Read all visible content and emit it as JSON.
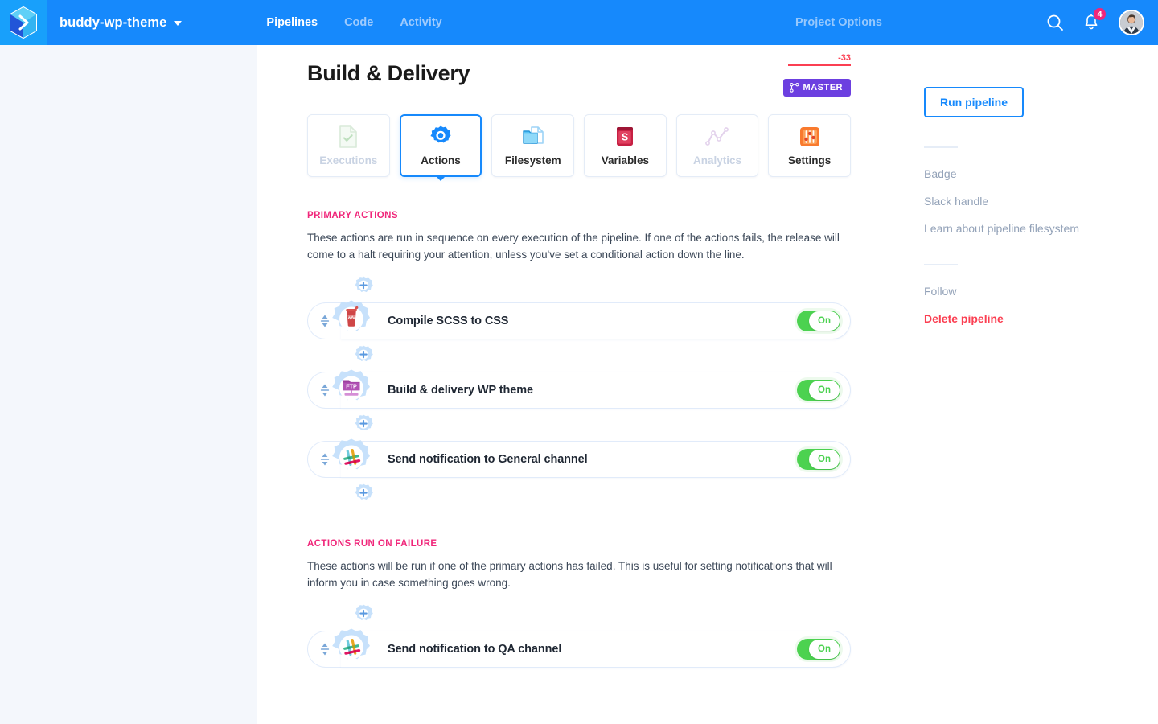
{
  "topbar": {
    "logo_icon": "buddy-hexagon-logo",
    "project_name": "buddy-wp-theme",
    "nav": [
      {
        "label": "Pipelines",
        "active": true
      },
      {
        "label": "Code",
        "active": false
      },
      {
        "label": "Activity",
        "active": false
      }
    ],
    "project_options_label": "Project Options",
    "search_icon": "search-icon",
    "notifications_icon": "bell-icon",
    "notifications_count": "4",
    "avatar": "user-avatar"
  },
  "header": {
    "title": "Build & Delivery",
    "delta": "-33",
    "branch_icon": "branch-icon",
    "branch": "MASTER"
  },
  "tabs": [
    {
      "label": "Executions",
      "icon": "document-check-icon",
      "active": false,
      "disabled": true
    },
    {
      "label": "Actions",
      "icon": "gear-icon",
      "active": true,
      "disabled": false
    },
    {
      "label": "Filesystem",
      "icon": "files-icon",
      "active": false,
      "disabled": false
    },
    {
      "label": "Variables",
      "icon": "dollar-book-icon",
      "active": false,
      "disabled": false
    },
    {
      "label": "Analytics",
      "icon": "line-chart-icon",
      "active": false,
      "disabled": true
    },
    {
      "label": "Settings",
      "icon": "sliders-icon",
      "active": false,
      "disabled": false
    }
  ],
  "primary_section": {
    "title": "PRIMARY ACTIONS",
    "description": "These actions are run in sequence on every execution of the pipeline. If one of the actions fails, the release will come to a halt requiring your attention, unless you've set a conditional action down the line.",
    "actions": [
      {
        "label": "Compile SCSS to CSS",
        "icon": "gulp-icon",
        "toggle": "On"
      },
      {
        "label": "Build & delivery WP theme",
        "icon": "ftp-icon",
        "toggle": "On"
      },
      {
        "label": "Send notification to General channel",
        "icon": "slack-icon",
        "toggle": "On"
      }
    ]
  },
  "failure_section": {
    "title": "ACTIONS RUN ON FAILURE",
    "description": "These actions will be run if one of the primary actions has failed. This is useful for setting notifications that will inform you in case something goes wrong.",
    "actions": [
      {
        "label": "Send notification to QA channel",
        "icon": "slack-icon",
        "toggle": "On"
      }
    ]
  },
  "add_action_icon": "add-action-plus-icon",
  "drag_handle_icon": "drag-handle-icon",
  "sidebar": {
    "run_button": "Run pipeline",
    "group1": [
      {
        "label": "Badge",
        "danger": false
      },
      {
        "label": "Slack handle",
        "danger": false
      },
      {
        "label": "Learn about pipeline filesystem",
        "danger": false
      }
    ],
    "group2": [
      {
        "label": "Follow",
        "danger": false
      },
      {
        "label": "Delete pipeline",
        "danger": true
      }
    ]
  },
  "colors": {
    "brand_blue": "#1689fc",
    "accent_pink": "#f0267a",
    "toggle_green": "#4cd250",
    "danger_red": "#fb3f52",
    "branch_purple": "#6c3fe0"
  }
}
